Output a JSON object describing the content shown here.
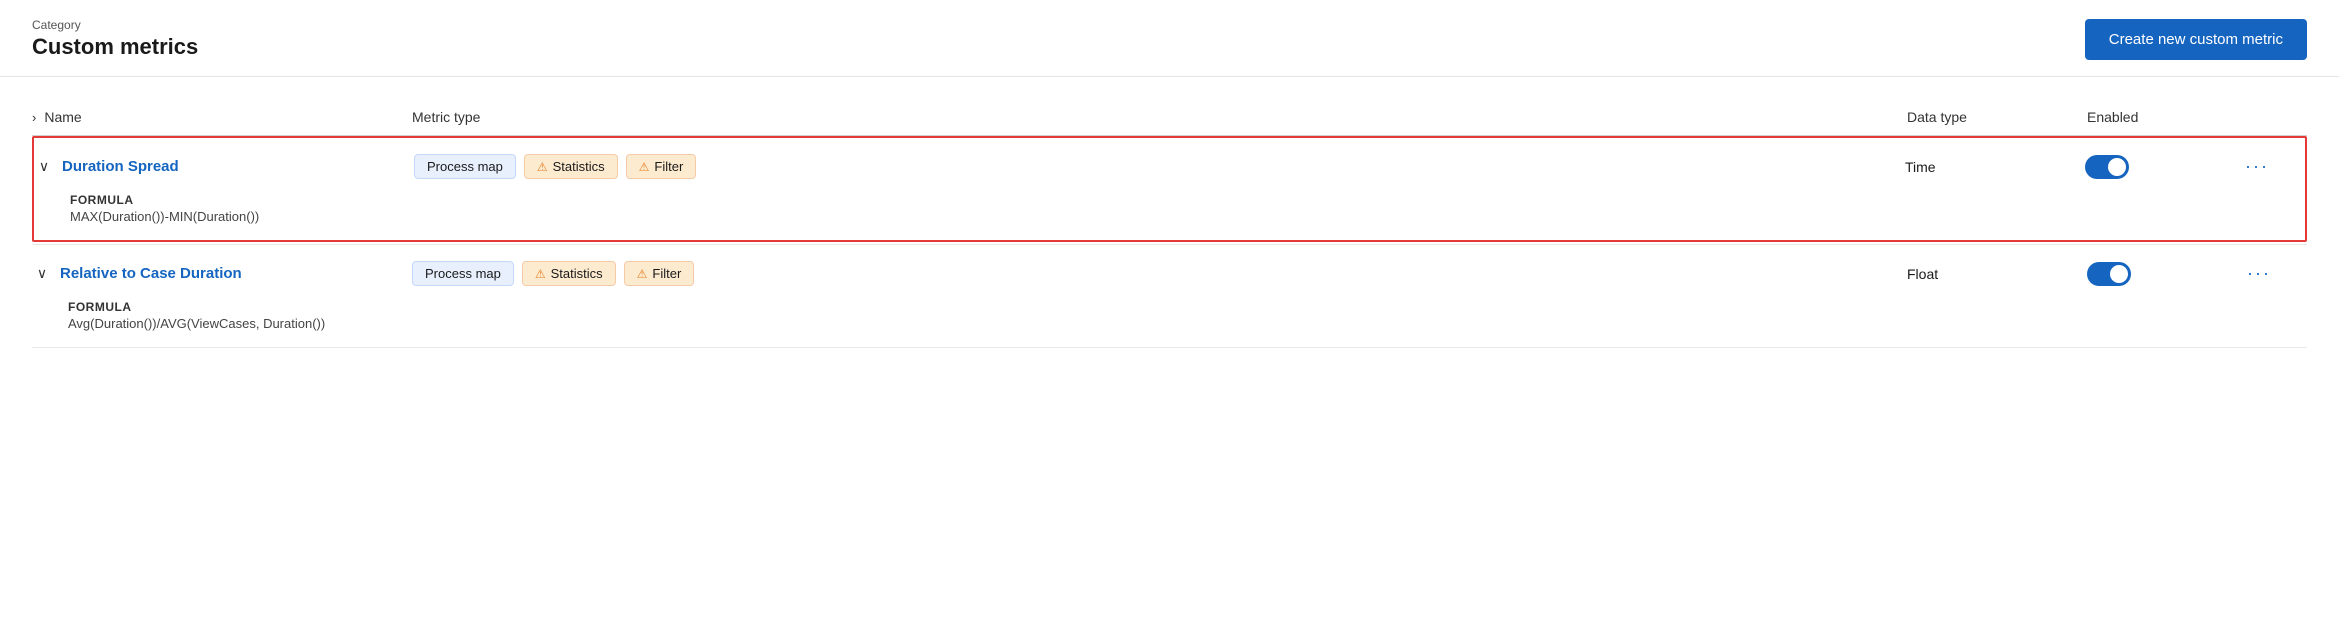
{
  "header": {
    "category_label": "Category",
    "page_title": "Custom metrics",
    "create_btn_label": "Create new custom metric"
  },
  "table": {
    "col_name": "Name",
    "col_metric_type": "Metric type",
    "col_data_type": "Data type",
    "col_enabled": "Enabled",
    "expand_icon": "›"
  },
  "rows": [
    {
      "id": "duration-spread",
      "name": "Duration Spread",
      "expanded": true,
      "selected": true,
      "formula_label": "FORMULA",
      "formula_value": "MAX(Duration())-MIN(Duration())",
      "tags": [
        {
          "label": "Process map",
          "type": "blue",
          "warn": false
        },
        {
          "label": "Statistics",
          "type": "orange",
          "warn": true
        },
        {
          "label": "Filter",
          "type": "orange",
          "warn": true
        }
      ],
      "data_type": "Time",
      "enabled": true
    },
    {
      "id": "relative-case-duration",
      "name": "Relative to Case Duration",
      "expanded": true,
      "selected": false,
      "formula_label": "FORMULA",
      "formula_value": "Avg(Duration())/AVG(ViewCases, Duration())",
      "tags": [
        {
          "label": "Process map",
          "type": "blue",
          "warn": false
        },
        {
          "label": "Statistics",
          "type": "orange",
          "warn": true
        },
        {
          "label": "Filter",
          "type": "orange",
          "warn": true
        }
      ],
      "data_type": "Float",
      "enabled": true
    }
  ]
}
